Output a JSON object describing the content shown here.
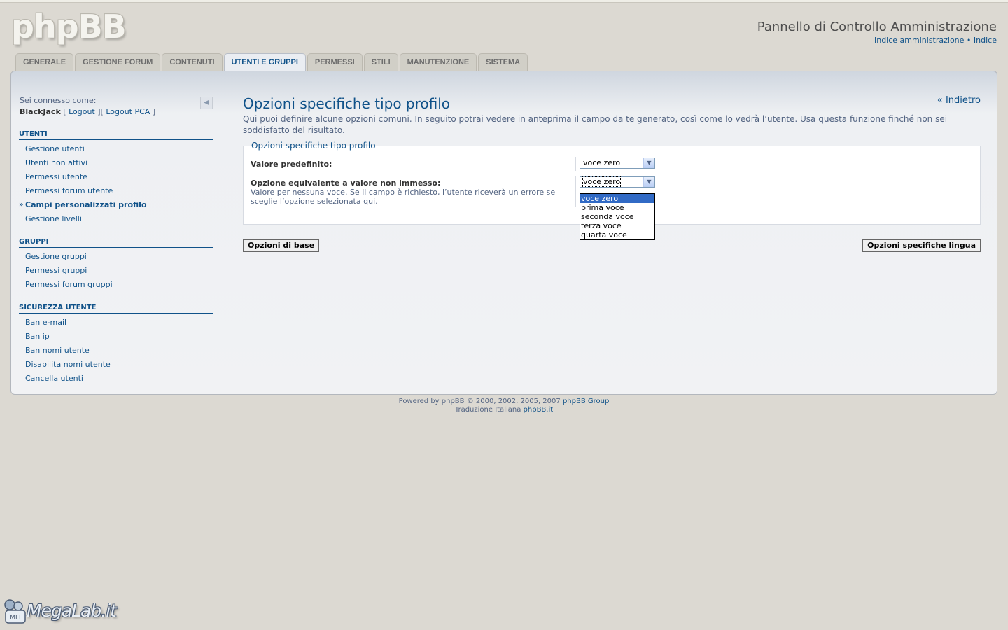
{
  "header": {
    "logo_text": "phpBB",
    "title": "Pannello di Controllo Amministrazione",
    "link_admin_index": "Indice amministrazione",
    "link_separator": "•",
    "link_index": "Indice"
  },
  "tabs": [
    {
      "label": "GENERALE"
    },
    {
      "label": "GESTIONE FORUM"
    },
    {
      "label": "CONTENUTI"
    },
    {
      "label": "UTENTI E GRUPPI",
      "active": true
    },
    {
      "label": "PERMESSI"
    },
    {
      "label": "STILI"
    },
    {
      "label": "MANUTENZIONE"
    },
    {
      "label": "SISTEMA"
    }
  ],
  "sidebar": {
    "logged_in_as": "Sei connesso come:",
    "username": "BlackJack",
    "logout": "Logout",
    "logout_acp": "Logout PCA",
    "sections": [
      {
        "title": "UTENTI",
        "items": [
          {
            "label": "Gestione utenti"
          },
          {
            "label": "Utenti non attivi"
          },
          {
            "label": "Permessi utente"
          },
          {
            "label": "Permessi forum utente"
          },
          {
            "label": "Campi personalizzati profilo",
            "active": true
          },
          {
            "label": "Gestione livelli"
          }
        ]
      },
      {
        "title": "GRUPPI",
        "items": [
          {
            "label": "Gestione gruppi"
          },
          {
            "label": "Permessi gruppi"
          },
          {
            "label": "Permessi forum gruppi"
          }
        ]
      },
      {
        "title": "SICUREZZA UTENTE",
        "items": [
          {
            "label": "Ban e-mail"
          },
          {
            "label": "Ban ip"
          },
          {
            "label": "Ban nomi utente"
          },
          {
            "label": "Disabilita nomi utente"
          },
          {
            "label": "Cancella utenti"
          }
        ]
      }
    ]
  },
  "main": {
    "title": "Opzioni specifiche tipo profilo",
    "back": "« Indietro",
    "intro": "Qui puoi definire alcune opzioni comuni. In seguito potrai vedere in anteprima il campo da te generato, così come lo vedrà l’utente. Usa questa funzione finché non sei soddisfatto del risultato.",
    "fieldset_legend": "Opzioni specifiche tipo profilo",
    "default_label": "Valore predefinito:",
    "default_value": "voce zero",
    "no_value_label": "Opzione equivalente a valore non immesso:",
    "no_value_explain": "Valore per nessuna voce. Se il campo è richiesto, l’utente riceverà un errore se sceglie l’opzione selezionata qui.",
    "no_value_value": "voce zero",
    "dropdown_options": [
      "voce zero",
      "prima voce",
      "seconda voce",
      "terza voce",
      "quarta voce"
    ],
    "dropdown_selected_index": 0,
    "btn_basic": "Opzioni di base",
    "btn_lang": "Opzioni specifiche lingua"
  },
  "footer": {
    "powered_prefix": "Powered by phpBB © 2000, 2002, 2005, 2007",
    "powered_link": "phpBB Group",
    "translation_prefix": "Traduzione Italiana",
    "translation_link": "phpBB.it"
  },
  "watermark": {
    "text": "MegaLab.it",
    "badge": "MLI"
  }
}
